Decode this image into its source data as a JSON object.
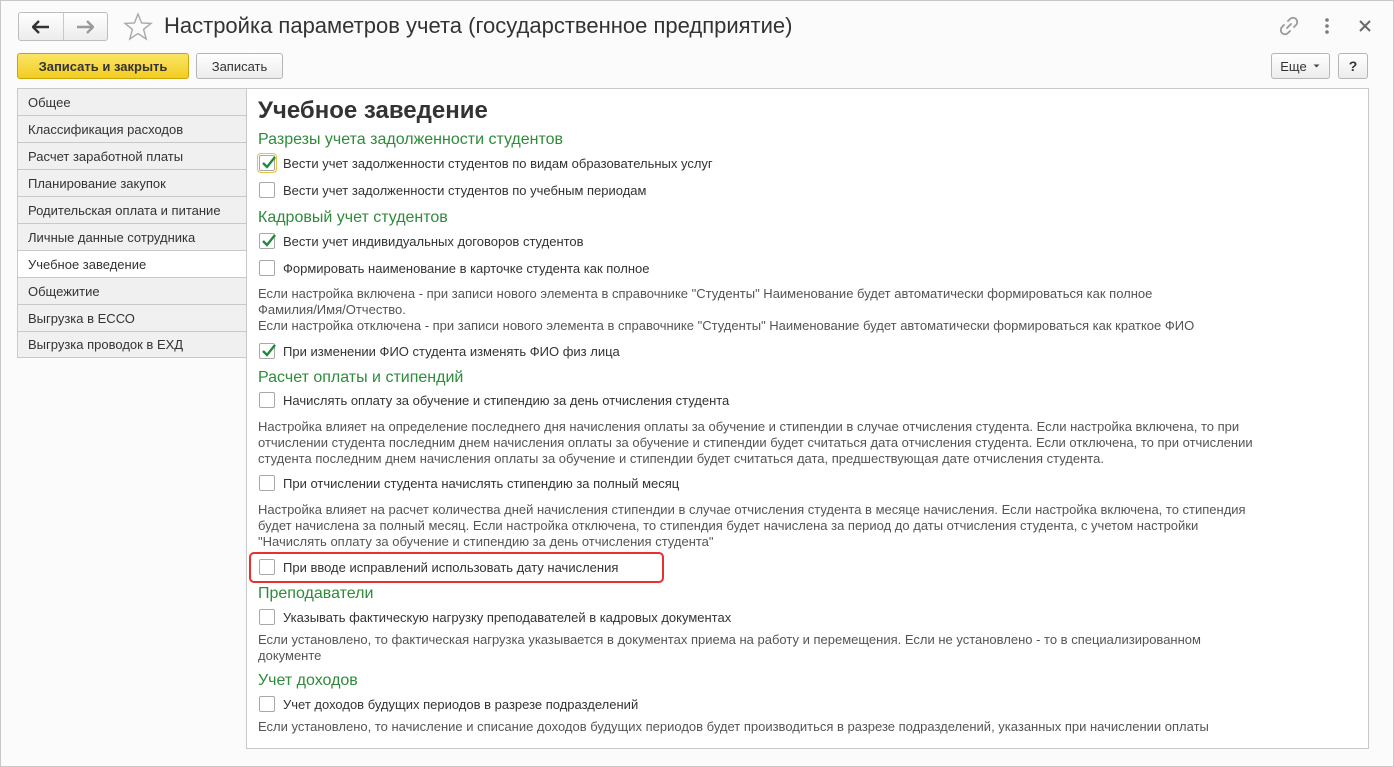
{
  "window": {
    "title": "Настройка параметров учета (государственное предприятие)",
    "icons": [
      "arrow-left-icon",
      "arrow-right-icon",
      "star-icon",
      "link-icon",
      "more-vertical-icon",
      "close-icon"
    ]
  },
  "toolbar": {
    "save_close_label": "Записать и закрыть",
    "save_label": "Записать",
    "more_label": "Еще",
    "help_label": "?"
  },
  "sidebar": {
    "items": [
      {
        "label": "Общее",
        "active": false
      },
      {
        "label": "Классификация расходов",
        "active": false
      },
      {
        "label": "Расчет заработной платы",
        "active": false
      },
      {
        "label": "Планирование закупок",
        "active": false
      },
      {
        "label": "Родительская оплата и питание",
        "active": false
      },
      {
        "label": "Личные данные сотрудника",
        "active": false
      },
      {
        "label": "Учебное заведение",
        "active": true
      },
      {
        "label": "Общежитие",
        "active": false
      },
      {
        "label": "Выгрузка в ЕССО",
        "active": false
      },
      {
        "label": "Выгрузка проводок в ЕХД",
        "active": false
      }
    ]
  },
  "main": {
    "heading": "Учебное заведение",
    "sections": {
      "debt": {
        "title": "Разрезы учета задолженности студентов",
        "opt1": {
          "label": "Вести учет задолженности студентов по видам образовательных услуг",
          "checked": true
        },
        "opt2": {
          "label": "Вести учет задолженности студентов по учебным периодам",
          "checked": false
        }
      },
      "hr": {
        "title": "Кадровый учет студентов",
        "opt1": {
          "label": "Вести учет индивидуальных договоров студентов",
          "checked": true
        },
        "opt2": {
          "label": "Формировать наименование в карточке  студента как полное",
          "checked": false
        },
        "note_line1": "Если настройка  включена - при записи нового элемента в  справочнике \"Студенты\"  Наименование  будет  автоматически формироваться  как полное",
        "note_line2": "Фамилия/Имя/Отчество.",
        "note_line3": "Если настройка отключена - при записи нового элемента  в  справочнике \"Студенты\"  Наименование  будет  автоматически формироваться  как краткое ФИО",
        "opt3": {
          "label": "При изменении ФИО студента изменять ФИО  физ лица",
          "checked": true
        }
      },
      "payment": {
        "title": "Расчет оплаты и стипендий",
        "opt1": {
          "label": "Начислять оплату за обучение и стипендию за день отчисления студента",
          "checked": false
        },
        "note1_line1": "Настройка влияет на определение последнего дня начисления оплаты за обучение и стипендии в случае отчисления студента. Если настройка включена, то при",
        "note1_line2": "отчислении студента последним днем начисления оплаты за обучение и стипендии будет считаться дата отчисления студента. Если отключена, то при отчислении",
        "note1_line3": "студента последним днем начисления оплаты за обучение и стипендии будет считаться дата, предшествующая дате отчисления студента.",
        "opt2": {
          "label": "При отчислении студента начислять стипендию за полный месяц",
          "checked": false
        },
        "note2_line1": "Настройка влияет на расчет количества дней начисления стипендии в случае отчисления студента в  месяце начисления. Если настройка включена, то  стипендия",
        "note2_line2": "будет начислена  за полный месяц. Если настройка отключена, то стипендия будет начислена за период до даты отчисления студента, с учетом  настройки",
        "note2_line3": "\"Начислять оплату за обучение и стипендию за день отчисления студента\"",
        "opt3": {
          "label": "При вводе исправлений использовать дату начисления",
          "checked": false
        }
      },
      "teachers": {
        "title": "Преподаватели",
        "opt1": {
          "label": "Указывать фактическую нагрузку преподавателей в кадровых документах",
          "checked": false
        },
        "note_line1": "Если установлено, то фактическая нагрузка указывается в документах приема на работу и перемещения. Если не установлено - то в специализированном",
        "note_line2": "документе"
      },
      "income": {
        "title": "Учет доходов",
        "opt1": {
          "label": "Учет доходов будущих периодов в разрезе подразделений",
          "checked": false
        },
        "note_line1": "Если установлено, то начисление и списание доходов будущих периодов будет производиться в разрезе подразделений, указанных при начислении оплаты"
      }
    }
  },
  "colors": {
    "accent_yellow": "#f2cc21",
    "section_green": "#2e8b3a",
    "checkmark_green": "#1f8a3a",
    "highlight_red": "#e8302e"
  }
}
